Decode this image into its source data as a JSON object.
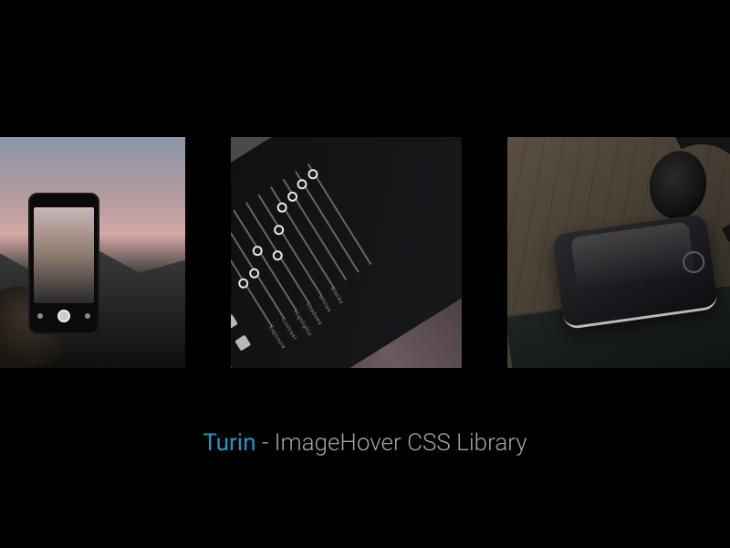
{
  "caption": {
    "brand": "Turin",
    "separator": " - ",
    "rest": "ImageHover CSS Library"
  },
  "thumbnails": [
    {
      "name": "phone-camera-dusk"
    },
    {
      "name": "tablet-editing-sliders"
    },
    {
      "name": "phone-headphones-wood"
    }
  ],
  "editing_labels": [
    "Exposure",
    "Contrast",
    "Highlights",
    "Shadows",
    "Whites",
    "Blacks"
  ],
  "colors": {
    "brand": "#2196c4",
    "text": "#9aa4af",
    "bg": "#000000"
  }
}
